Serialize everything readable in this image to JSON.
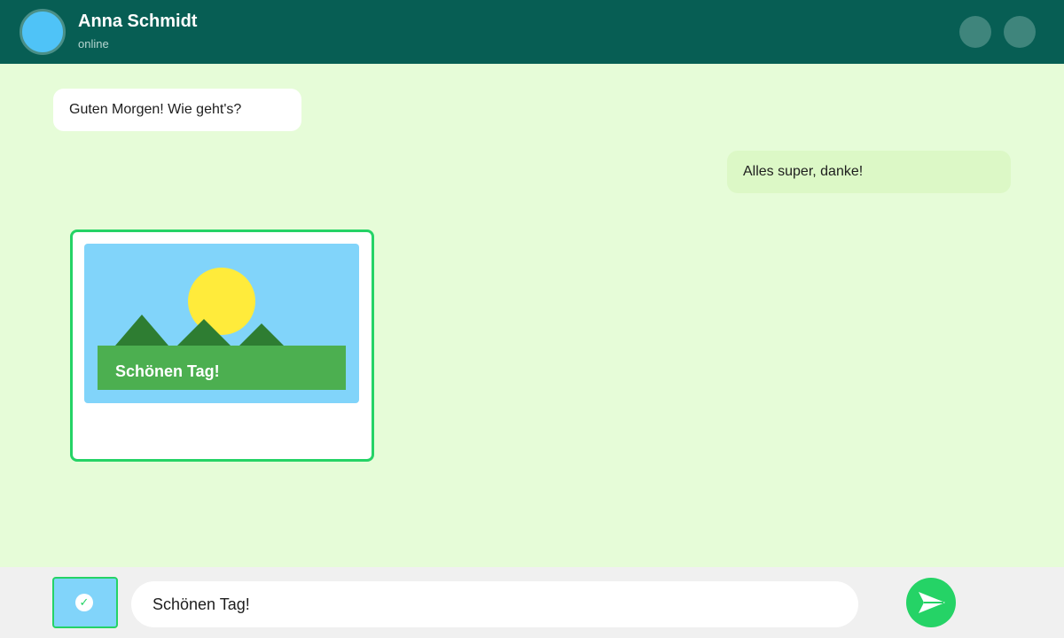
{
  "header": {
    "contact_name": "Anna Schmidt",
    "status": "online",
    "icons": [
      "avatar",
      "header-action-1",
      "header-action-2"
    ]
  },
  "messages": [
    {
      "direction": "incoming",
      "text": "Guten Morgen! Wie geht's?"
    },
    {
      "direction": "outgoing",
      "text": "Alles super, danke!"
    }
  ],
  "image_message": {
    "caption": "Schönen Tag!",
    "icons": [
      "sun",
      "mountains",
      "meadow"
    ]
  },
  "composer": {
    "input_value": "Schönen Tag!",
    "check_glyph": "✓",
    "icons": [
      "image-thumbnail-icon",
      "checkmark-icon",
      "send-icon"
    ]
  },
  "colors": {
    "header_bg": "#075e54",
    "chat_bg": "#e6fcd8",
    "outgoing_bubble": "#dcf8c6",
    "accent": "#25d366"
  }
}
